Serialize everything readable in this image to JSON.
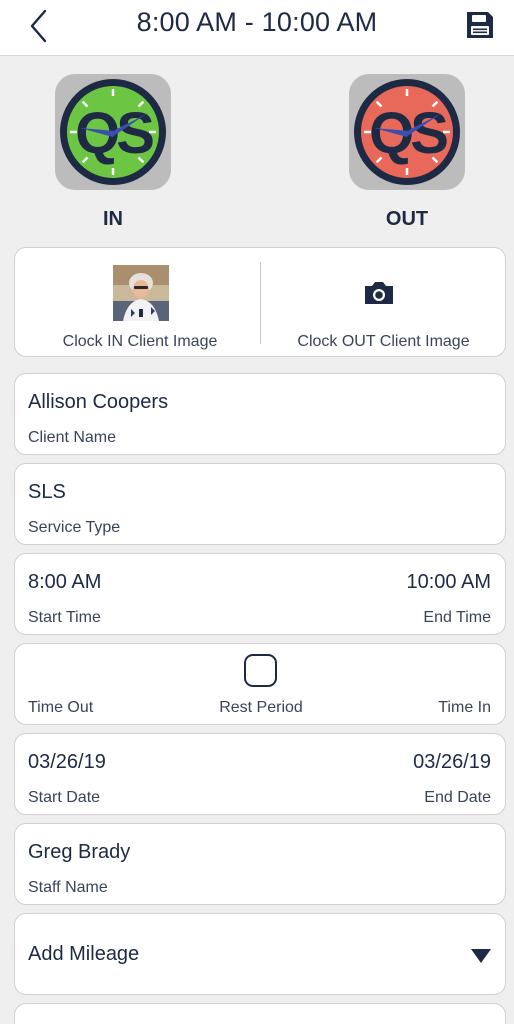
{
  "header": {
    "title": "8:00 AM - 10:00 AM",
    "back_icon": "chevron-left-icon",
    "save_icon": "floppy-disk-icon"
  },
  "clock": {
    "in_label": "IN",
    "out_label": "OUT",
    "logo_text": "QS",
    "in_color": "#6cc644",
    "out_color": "#e8685a",
    "frame_color": "#1e2a44",
    "hand_color": "#3a4fb0"
  },
  "images": {
    "in_label": "Clock IN Client Image",
    "out_label": "Clock OUT Client Image",
    "out_icon": "camera-icon"
  },
  "client": {
    "value": "Allison Coopers",
    "label": "Client Name"
  },
  "service": {
    "value": "SLS",
    "label": "Service Type"
  },
  "time": {
    "start_value": "8:00 AM",
    "end_value": "10:00 AM",
    "start_label": "Start Time",
    "end_label": "End Time"
  },
  "rest": {
    "time_out_label": "Time Out",
    "rest_label": "Rest Period",
    "time_in_label": "Time In",
    "checked": false
  },
  "dates": {
    "start_value": "03/26/19",
    "end_value": "03/26/19",
    "start_label": "Start Date",
    "end_label": "End Date"
  },
  "staff": {
    "value": "Greg Brady",
    "label": "Staff Name"
  },
  "mileage": {
    "label": "Add Mileage",
    "icon": "triangle-down-icon"
  }
}
